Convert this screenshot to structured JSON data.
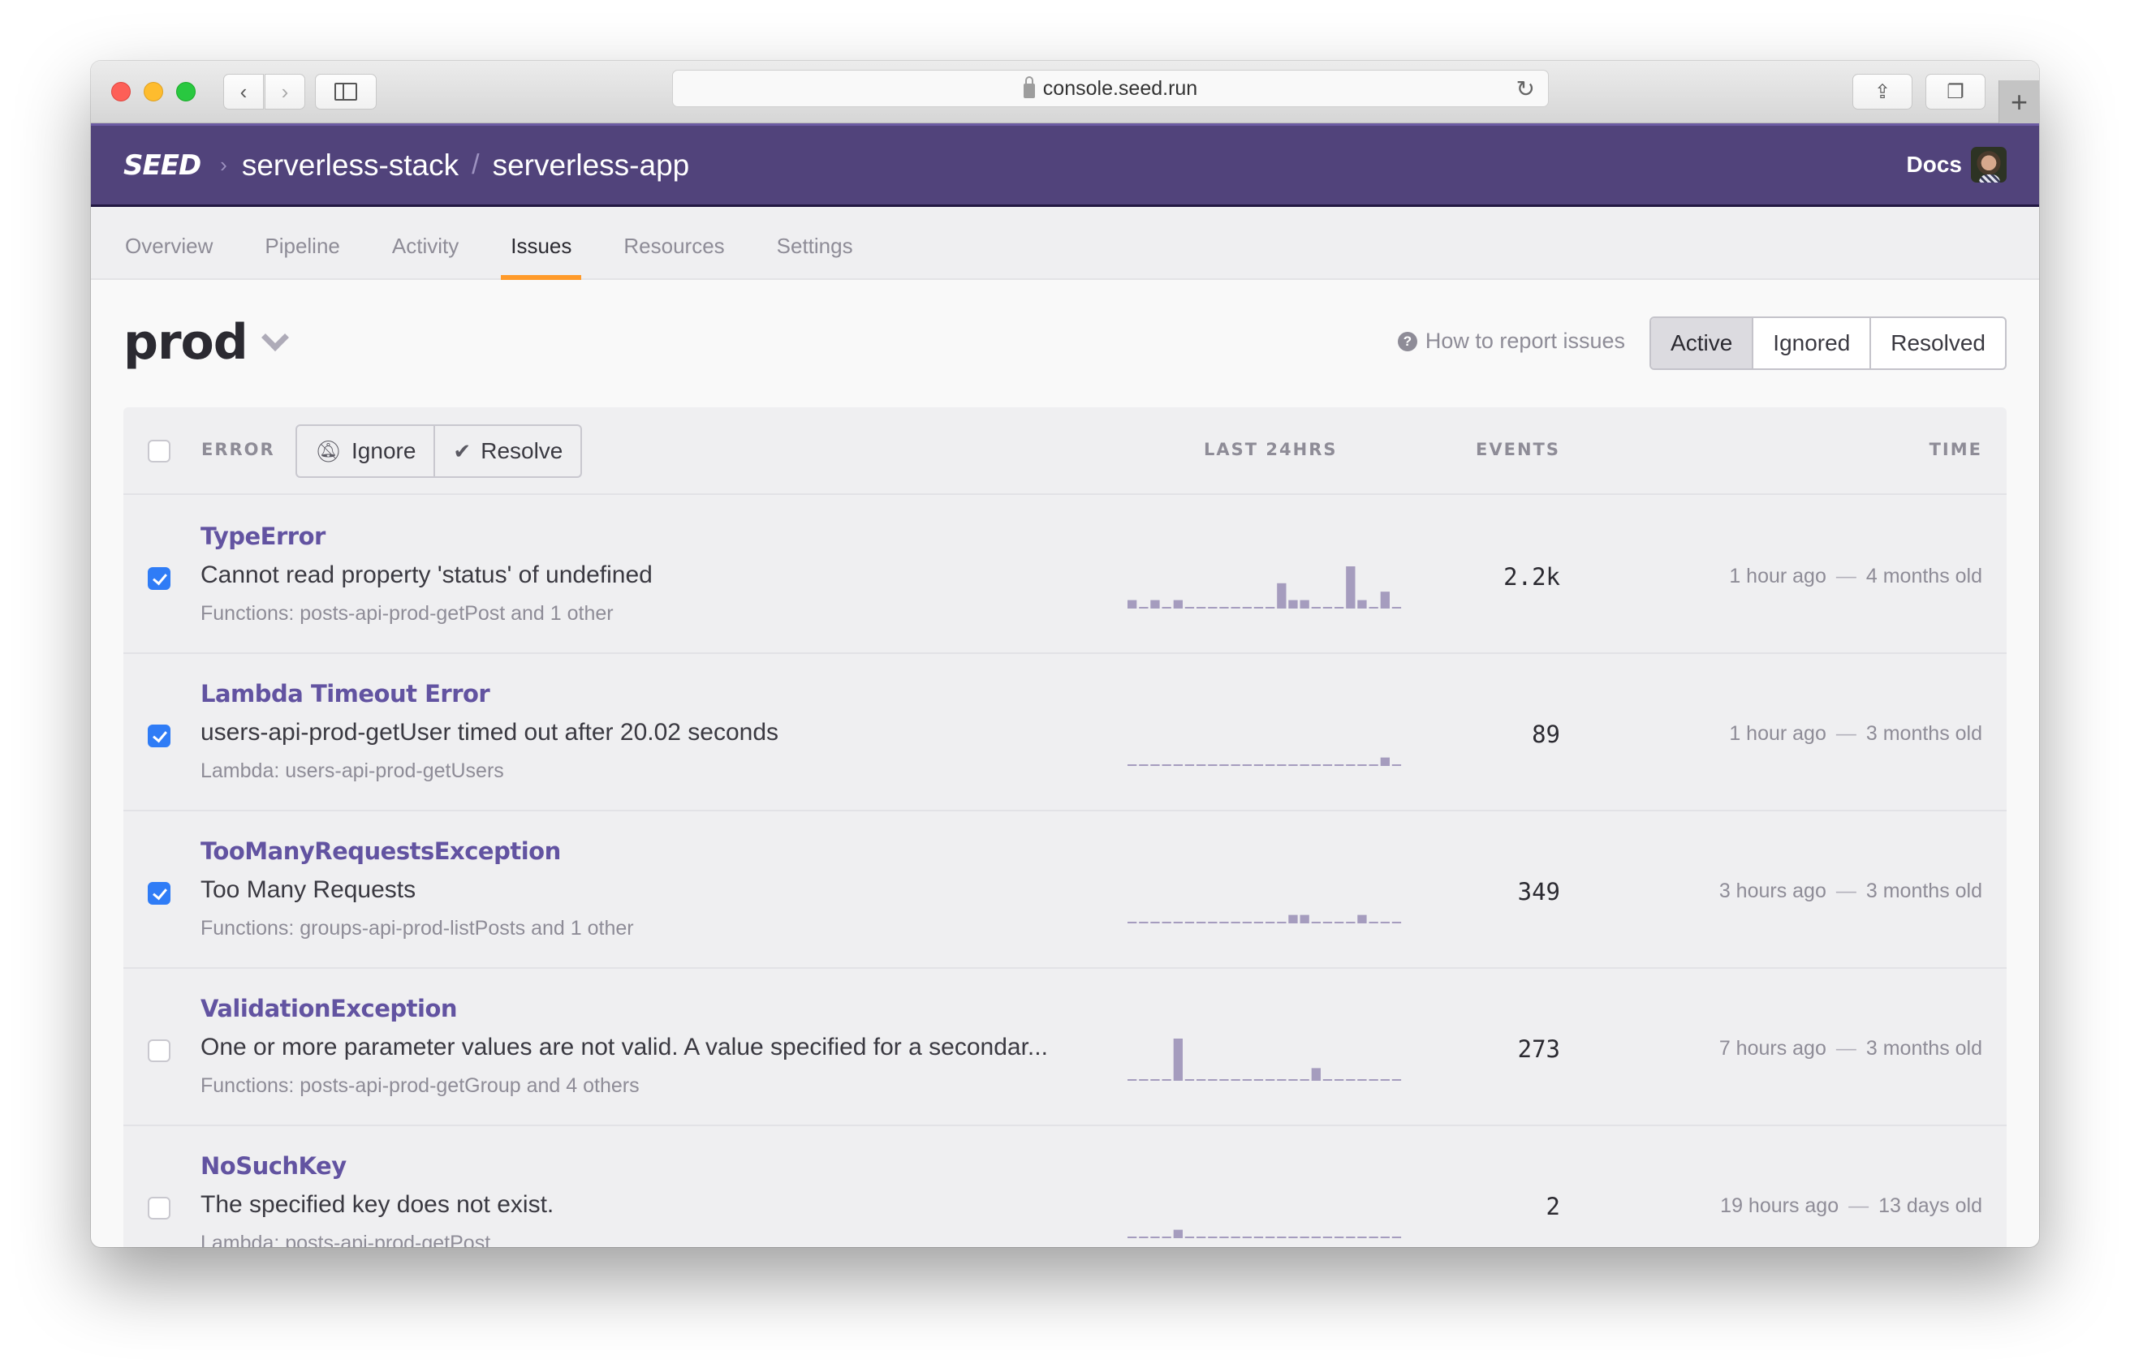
{
  "browser": {
    "url": "console.seed.run",
    "icons": [
      "back-icon",
      "forward-icon",
      "sidebar-icon",
      "lock-icon",
      "reload-icon",
      "share-icon",
      "tabs-icon",
      "new-tab-icon"
    ]
  },
  "header": {
    "logo": "SEED",
    "org": "serverless-stack",
    "app": "serverless-app",
    "docs_label": "Docs"
  },
  "tabs": [
    {
      "label": "Overview",
      "active": false
    },
    {
      "label": "Pipeline",
      "active": false
    },
    {
      "label": "Activity",
      "active": false
    },
    {
      "label": "Issues",
      "active": true
    },
    {
      "label": "Resources",
      "active": false
    },
    {
      "label": "Settings",
      "active": false
    }
  ],
  "stage": {
    "name": "prod",
    "help_label": "How to report issues",
    "filters": [
      {
        "label": "Active",
        "active": true
      },
      {
        "label": "Ignored",
        "active": false
      },
      {
        "label": "Resolved",
        "active": false
      }
    ]
  },
  "table": {
    "columns": {
      "error": "ERROR",
      "last24": "LAST 24HRS",
      "events": "EVENTS",
      "time": "TIME"
    },
    "actions": {
      "ignore": "Ignore",
      "resolve": "Resolve"
    },
    "rows": [
      {
        "checked": true,
        "title": "TypeError",
        "message": "Cannot read property 'status' of undefined",
        "source": "Functions: posts-api-prod-getPost and 1 other",
        "events": "2.2k",
        "last_seen": "1 hour ago",
        "age": "4 months old",
        "hourly": [
          2,
          0,
          2,
          0,
          2,
          0,
          0,
          0,
          0,
          0,
          0,
          0,
          0,
          6,
          2,
          2,
          0,
          0,
          0,
          10,
          2,
          0,
          4,
          0
        ]
      },
      {
        "checked": true,
        "title": "Lambda Timeout Error",
        "message": "users-api-prod-getUser timed out after 20.02 seconds",
        "source": "Lambda: users-api-prod-getUsers",
        "events": "89",
        "last_seen": "1 hour ago",
        "age": "3 months old",
        "hourly": [
          0,
          0,
          0,
          0,
          0,
          0,
          0,
          0,
          0,
          0,
          0,
          0,
          0,
          0,
          0,
          0,
          0,
          0,
          0,
          0,
          0,
          0,
          2,
          0
        ]
      },
      {
        "checked": true,
        "title": "TooManyRequestsException",
        "message": "Too Many Requests",
        "source": "Functions: groups-api-prod-listPosts and 1 other",
        "events": "349",
        "last_seen": "3 hours ago",
        "age": "3 months old",
        "hourly": [
          0,
          0,
          0,
          0,
          0,
          0,
          0,
          0,
          0,
          0,
          0,
          0,
          0,
          0,
          2,
          2,
          0,
          0,
          0,
          0,
          2,
          0,
          0,
          0
        ]
      },
      {
        "checked": false,
        "title": "ValidationException",
        "message": "One or more parameter values are not valid. A value specified for a secondar...",
        "source": "Functions: posts-api-prod-getGroup and 4 others",
        "events": "273",
        "last_seen": "7 hours ago",
        "age": "3 months old",
        "hourly": [
          0,
          0,
          0,
          0,
          10,
          0,
          0,
          0,
          0,
          0,
          0,
          0,
          0,
          0,
          0,
          0,
          3,
          0,
          0,
          0,
          0,
          0,
          0,
          0
        ]
      },
      {
        "checked": false,
        "title": "NoSuchKey",
        "message": "The specified key does not exist.",
        "source": "Lambda: posts-api-prod-getPost",
        "events": "2",
        "last_seen": "19 hours ago",
        "age": "13 days old",
        "hourly": [
          0,
          0,
          0,
          0,
          2,
          0,
          0,
          0,
          0,
          0,
          0,
          0,
          0,
          0,
          0,
          0,
          0,
          0,
          0,
          0,
          0,
          0,
          0,
          0
        ]
      }
    ]
  },
  "colors": {
    "brand": "#51437b",
    "accent": "#ff9a2a",
    "link": "#6253a1",
    "checkbox": "#2f7cf6",
    "spark": "#a59cbe"
  }
}
